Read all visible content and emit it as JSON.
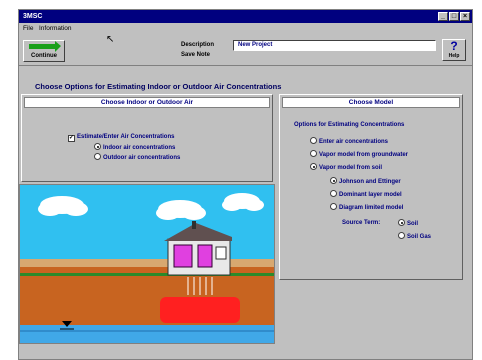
{
  "titlebar": {
    "title": "3MSC"
  },
  "window_controls": {
    "minimize": "_",
    "maximize": "□",
    "close": "×"
  },
  "menu": {
    "file": "File",
    "information": "Information"
  },
  "toolbar": {
    "continue_label": "Continue",
    "description_label": "Description",
    "description_value": "New Project",
    "session_label": "Save Note",
    "help_symbol": "?",
    "help_label": "Help"
  },
  "heading": "Choose Options for Estimating Indoor or Outdoor Air Concentrations",
  "air_panel": {
    "title": "Choose Indoor or Outdoor Air",
    "checkbox_label": "Estimate/Enter Air Concentrations",
    "checkbox_checked": true,
    "options": [
      {
        "label": "Indoor air concentrations",
        "selected": true
      },
      {
        "label": "Outdoor air concentrations",
        "selected": false
      }
    ]
  },
  "model_panel": {
    "title": "Choose Model",
    "subtitle": "Options for Estimating Concentrations",
    "options": [
      {
        "label": "Enter air concentrations",
        "selected": false
      },
      {
        "label": "Vapor model from groundwater",
        "selected": false
      },
      {
        "label": "Vapor model from soil",
        "selected": true
      }
    ],
    "sub_options": [
      {
        "label": "Johnson and Ettinger",
        "selected": true
      },
      {
        "label": "Dominant layer model",
        "selected": false
      },
      {
        "label": "Diagram limited model",
        "selected": false
      }
    ],
    "source_term_label": "Source Term:",
    "source_term_options": [
      {
        "label": "Soil",
        "selected": true
      },
      {
        "label": "Soil Gas",
        "selected": false
      }
    ]
  },
  "colors": {
    "title_bar": "#00007f",
    "sky": "#30c0f0",
    "soil": "#c86420",
    "contamination": "#ff2020",
    "groundwater": "#40a8e8",
    "house": "#e8e8e8",
    "grass": "#2a8a2a"
  }
}
